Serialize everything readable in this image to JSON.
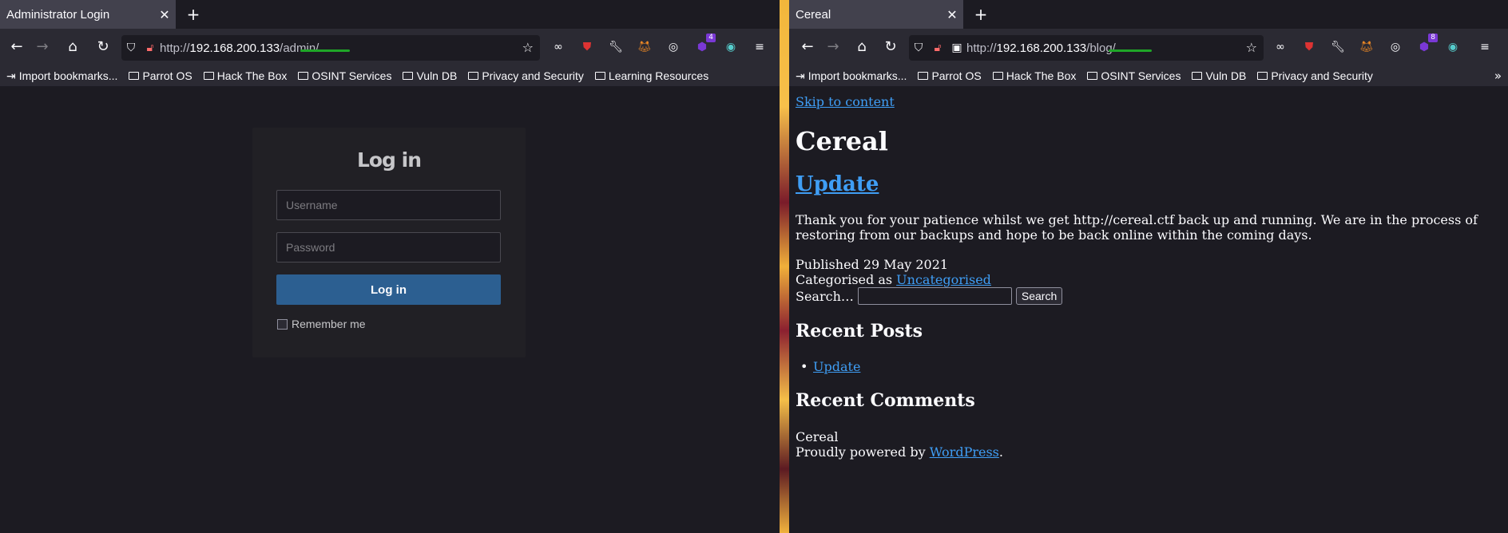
{
  "left": {
    "tab_title": "Administrator Login",
    "url_scheme": "http://",
    "url_host": "192.168.200.133",
    "url_path": "/admin/",
    "bookmarks": [
      "Import bookmarks...",
      "Parrot OS",
      "Hack The Box",
      "OSINT Services",
      "Vuln DB",
      "Privacy and Security",
      "Learning Resources"
    ],
    "ext_badge": "4",
    "login": {
      "title": "Log in",
      "username_placeholder": "Username",
      "password_placeholder": "Password",
      "button": "Log in",
      "remember": "Remember me"
    }
  },
  "right": {
    "tab_title": "Cereal",
    "url_scheme": "http://",
    "url_host": "192.168.200.133",
    "url_path": "/blog/",
    "bookmarks": [
      "Import bookmarks...",
      "Parrot OS",
      "Hack The Box",
      "OSINT Services",
      "Vuln DB",
      "Privacy and Security"
    ],
    "ext_badge": "8",
    "blog": {
      "skip": "Skip to content",
      "site_title": "Cereal",
      "post_title": "Update",
      "post_body": "Thank you for your patience whilst we get http://cereal.ctf back up and running. We are in the process of restoring from our backups and hope to be back online within the coming days.",
      "published": "Published 29 May 2021",
      "categorised_prefix": "Categorised as ",
      "category": "Uncategorised",
      "search_label": "Search…",
      "search_button": "Search",
      "recent_posts_heading": "Recent Posts",
      "recent_posts": [
        "Update"
      ],
      "recent_comments_heading": "Recent Comments",
      "footer_site": "Cereal",
      "footer_powered_prefix": "Proudly powered by ",
      "footer_wordpress": "WordPress",
      "footer_period": "."
    }
  },
  "colors": {
    "accent_link": "#3f9ef5",
    "login_button": "#2c5f91",
    "url_underline": "#1fa628"
  }
}
